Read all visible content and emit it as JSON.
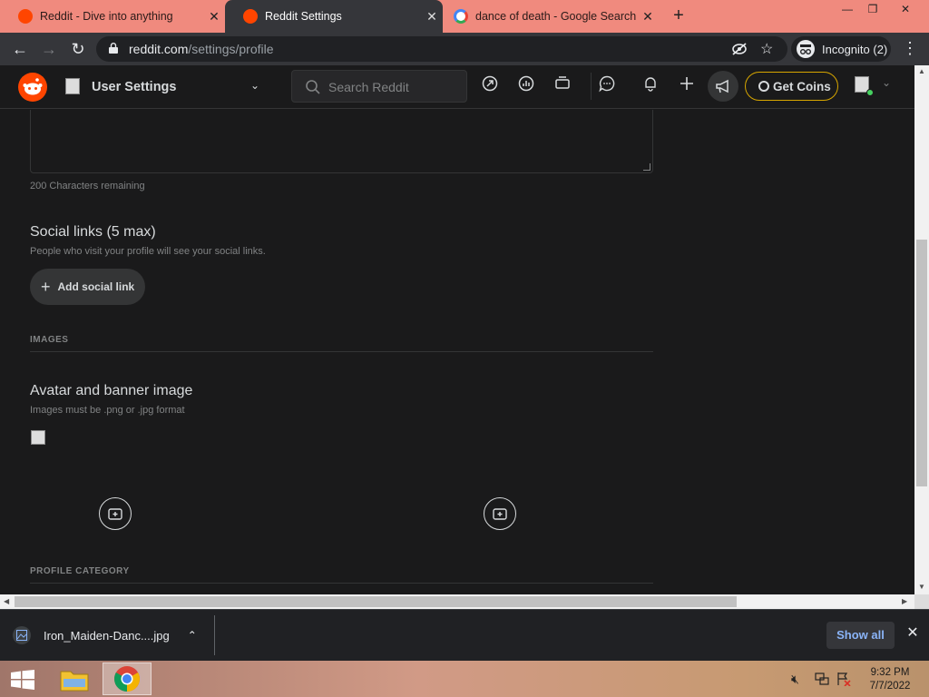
{
  "browser": {
    "tabs": [
      {
        "title": "Reddit - Dive into anything",
        "favicon": "reddit-icon",
        "active": false
      },
      {
        "title": "Reddit Settings",
        "favicon": "reddit-icon",
        "active": true
      },
      {
        "title": "dance of death - Google Search",
        "favicon": "google-icon",
        "active": false
      }
    ],
    "new_tab_label": "+",
    "url_host": "reddit.com",
    "url_path": "/settings/profile",
    "profile_label": "Incognito (2)"
  },
  "reddit": {
    "community_label": "User Settings",
    "search_placeholder": "Search Reddit",
    "get_coins_label": "Get Coins",
    "header_icons": [
      "popular-icon",
      "stats-icon",
      "video-icon",
      "chat-icon",
      "bell-icon",
      "plus-icon",
      "advertise-icon"
    ]
  },
  "settings": {
    "chars_remaining": "200 Characters remaining",
    "social_title": "Social links (5 max)",
    "social_desc": "People who visit your profile will see your social links.",
    "add_social_label": "Add social link",
    "images_section": "IMAGES",
    "avatar_title": "Avatar and banner image",
    "avatar_desc": "Images must be .png or .jpg format",
    "profile_category_section": "PROFILE CATEGORY"
  },
  "downloads": {
    "file_name": "Iron_Maiden-Danc....jpg",
    "show_all_label": "Show all"
  },
  "taskbar": {
    "time": "9:32 PM",
    "date": "7/7/2022"
  },
  "colors": {
    "reddit_orange": "#ff4500",
    "coins_border": "#d7a600",
    "chrome_tab_bar": "#f08a7e",
    "link_blue": "#8ab4f8"
  }
}
